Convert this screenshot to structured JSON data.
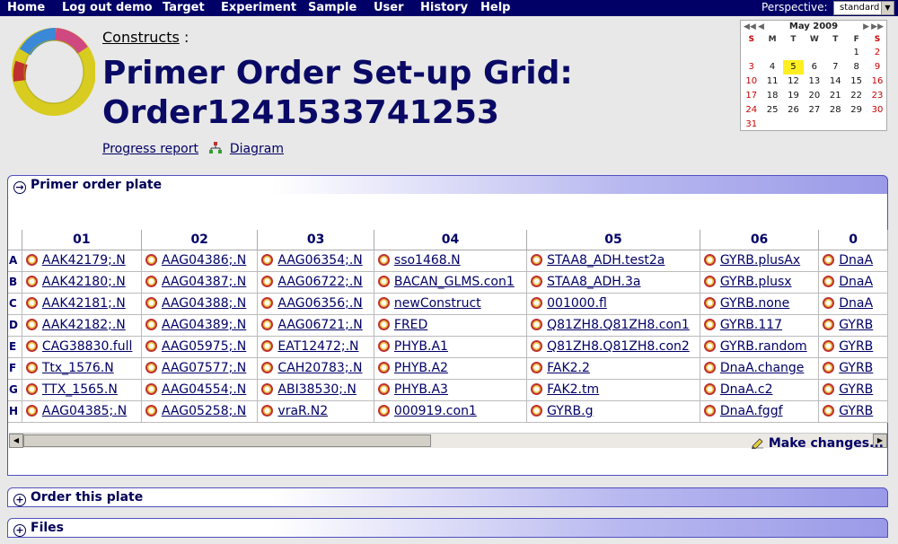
{
  "menu": [
    "Home",
    "Log out demo",
    "Target",
    "Experiment",
    "Sample",
    "User",
    "History",
    "Help"
  ],
  "perspective": {
    "label": "Perspective:",
    "value": "standard"
  },
  "breadcrumb": {
    "label": "Constructs",
    "suffix": ":"
  },
  "title": {
    "line1": "Primer Order Set-up Grid:",
    "line2": "Order1241533741253"
  },
  "links": {
    "progress": "Progress report",
    "diagram": "Diagram"
  },
  "calendar": {
    "month": "May 2009",
    "dows": [
      "S",
      "M",
      "T",
      "W",
      "T",
      "F",
      "S"
    ],
    "weeks": [
      [
        "",
        "",
        "",
        "",
        "",
        "1",
        "2"
      ],
      [
        "3",
        "4",
        "5",
        "6",
        "7",
        "8",
        "9"
      ],
      [
        "10",
        "11",
        "12",
        "13",
        "14",
        "15",
        "16"
      ],
      [
        "17",
        "18",
        "19",
        "20",
        "21",
        "22",
        "23"
      ],
      [
        "24",
        "25",
        "26",
        "27",
        "28",
        "29",
        "30"
      ],
      [
        "31",
        "",
        "",
        "",
        "",
        "",
        ""
      ]
    ],
    "today": "5"
  },
  "panels": {
    "plate": "Primer order plate",
    "order": "Order this plate",
    "files": "Files"
  },
  "plate": {
    "columns": [
      "01",
      "02",
      "03",
      "04",
      "05",
      "06",
      "0"
    ],
    "rows": [
      {
        "label": "A",
        "cells": [
          "AAK42179;.N",
          "AAG04386;.N",
          "AAG06354;.N",
          "sso1468.N",
          "STAA8_ADH.test2a",
          "GYRB.plusAx",
          "DnaA"
        ]
      },
      {
        "label": "B",
        "cells": [
          "AAK42180;.N",
          "AAG04387;.N",
          "AAG06722;.N",
          "BACAN_GLMS.con1",
          "STAA8_ADH.3a",
          "GYRB.plusx",
          "DnaA"
        ]
      },
      {
        "label": "C",
        "cells": [
          "AAK42181;.N",
          "AAG04388;.N",
          "AAG06356;.N",
          "newConstruct",
          "001000.fl",
          "GYRB.none",
          "DnaA"
        ]
      },
      {
        "label": "D",
        "cells": [
          "AAK42182;.N",
          "AAG04389;.N",
          "AAG06721;.N",
          "FRED",
          "Q81ZH8.Q81ZH8.con1",
          "GYRB.117",
          "GYRB"
        ]
      },
      {
        "label": "E",
        "cells": [
          "CAG38830.full",
          "AAG05975;.N",
          "EAT12472;.N",
          "PHYB.A1",
          "Q81ZH8.Q81ZH8.con2",
          "GYRB.random",
          "GYRB"
        ]
      },
      {
        "label": "F",
        "cells": [
          "Ttx_1576.N",
          "AAG07577;.N",
          "CAH20783;.N",
          "PHYB.A2",
          "FAK2.2",
          "DnaA.change",
          "GYRB"
        ]
      },
      {
        "label": "G",
        "cells": [
          "TTX_1565.N",
          "AAG04554;.N",
          "ABI38530;.N",
          "PHYB.A3",
          "FAK2.tm",
          "DnaA.c2",
          "GYRB"
        ]
      },
      {
        "label": "H",
        "cells": [
          "AAG04385;.N",
          "AAG05258;.N",
          "vraR.N2",
          "000919.con1",
          "GYRB.g",
          "DnaA.fggf",
          "GYRB"
        ]
      }
    ]
  },
  "make_changes": "Make changes...",
  "colors": {
    "menubar": "#000066",
    "title": "#0a0a66",
    "panel_border": "#5050c0"
  }
}
